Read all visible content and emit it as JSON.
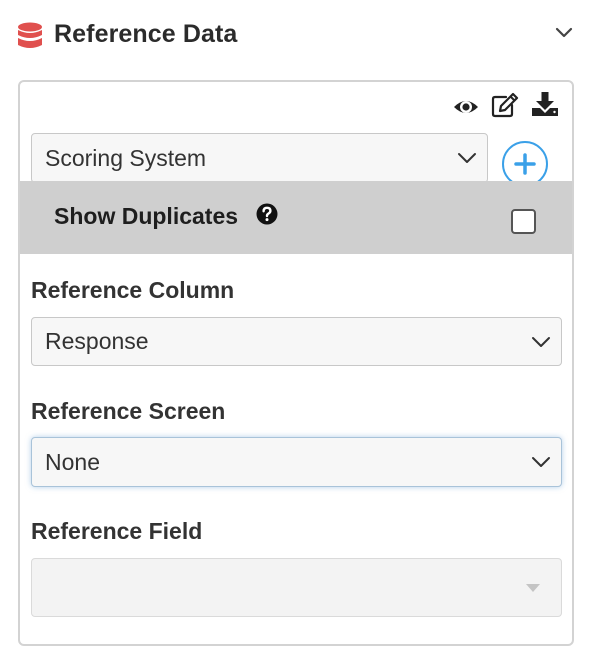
{
  "header": {
    "title": "Reference Data",
    "icon": "database-icon",
    "accent_color": "#e0504e"
  },
  "toolbar": {
    "icons": [
      "eye-icon",
      "edit-icon",
      "download-icon"
    ]
  },
  "reference_data_select": {
    "value": "Scoring System"
  },
  "add_button": {
    "icon": "plus-icon",
    "color": "#3aa0e8"
  },
  "show_duplicates": {
    "label": "Show Duplicates",
    "checked": false
  },
  "reference_column": {
    "label": "Reference Column",
    "value": "Response"
  },
  "reference_screen": {
    "label": "Reference Screen",
    "value": "None"
  },
  "reference_field": {
    "label": "Reference Field",
    "value": ""
  }
}
